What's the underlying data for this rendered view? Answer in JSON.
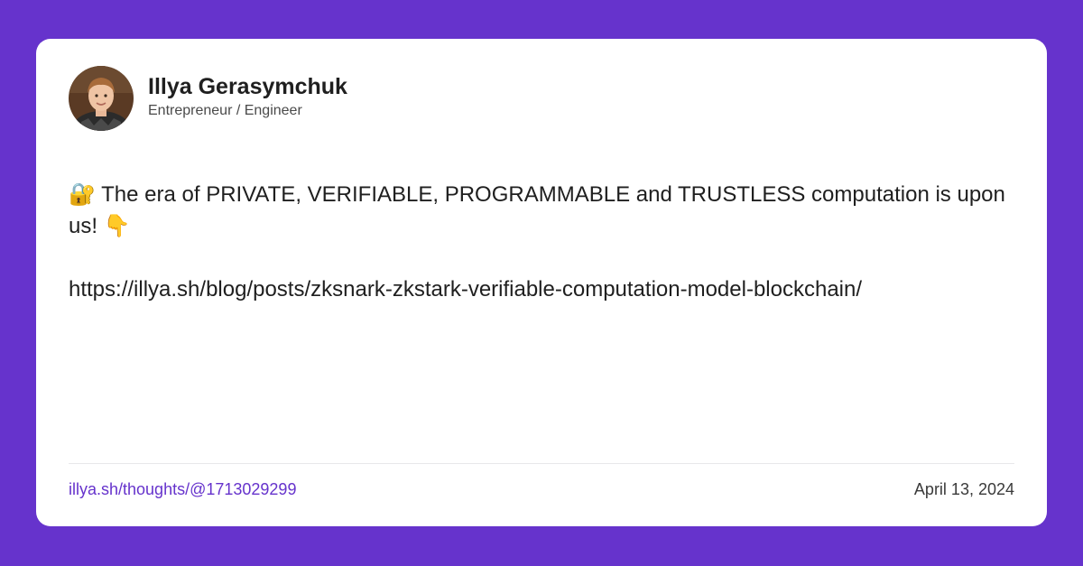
{
  "colors": {
    "background": "#6633cc",
    "card": "#ffffff",
    "text": "#1f1f1f",
    "accent": "#6633cc",
    "muted": "#4a4a4a",
    "divider": "#e8e8ea"
  },
  "author": {
    "name": "Illya Gerasymchuk",
    "role": "Entrepreneur / Engineer",
    "avatar_icon": "avatar-photo"
  },
  "post": {
    "lock_emoji": "🔐",
    "text_main": " The era of PRIVATE, VERIFIABLE, PROGRAMMABLE and TRUSTLESS computation is upon us! ",
    "pointing_emoji": "👇",
    "link": "https://illya.sh/blog/posts/zksnark-zkstark-verifiable-computation-model-blockchain/"
  },
  "footer": {
    "permalink": "illya.sh/thoughts/@1713029299",
    "date": "April 13, 2024"
  }
}
